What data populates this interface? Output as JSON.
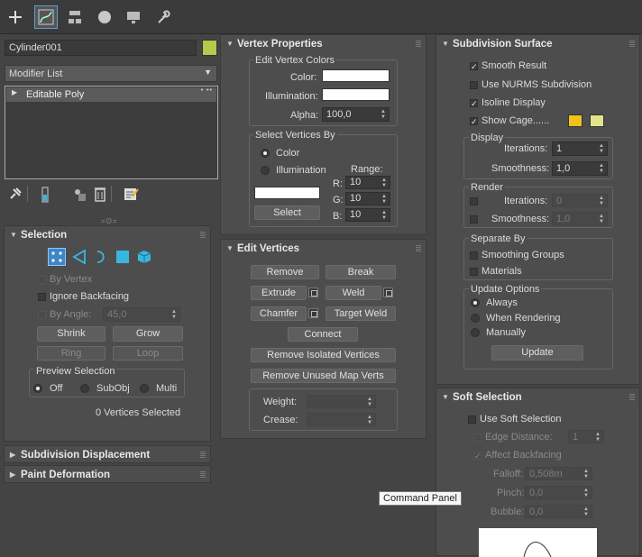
{
  "object_name": "Cylinder001",
  "object_color": "#b5c94a",
  "modifier_list": "Modifier List",
  "stack_item": "Editable Poly",
  "selection": {
    "title": "Selection",
    "by_vertex": "By Vertex",
    "ignore_backfacing": "Ignore Backfacing",
    "by_angle": "By Angle:",
    "angle_value": "45,0",
    "shrink": "Shrink",
    "grow": "Grow",
    "ring": "Ring",
    "loop": "Loop",
    "preview_title": "Preview Selection",
    "off": "Off",
    "subobj": "SubObj",
    "multi": "Multi",
    "status": "0 Vertices Selected"
  },
  "subdivision_displacement": "Subdivision Displacement",
  "paint_deformation": "Paint Deformation",
  "vertex_properties": {
    "title": "Vertex Properties",
    "edit_colors": "Edit Vertex Colors",
    "color": "Color:",
    "illumination": "Illumination:",
    "alpha": "Alpha:",
    "alpha_value": "100,0",
    "select_by": "Select Vertices By",
    "opt_color": "Color",
    "opt_illumination": "Illumination",
    "range": "Range:",
    "r": "R:",
    "g": "G:",
    "b": "B:",
    "r_val": "10",
    "g_val": "10",
    "b_val": "10",
    "select": "Select"
  },
  "edit_vertices": {
    "title": "Edit Vertices",
    "remove": "Remove",
    "break": "Break",
    "extrude": "Extrude",
    "weld": "Weld",
    "chamfer": "Chamfer",
    "target_weld": "Target Weld",
    "connect": "Connect",
    "remove_isolated": "Remove Isolated Vertices",
    "remove_unused": "Remove Unused Map Verts",
    "weight": "Weight:",
    "crease": "Crease:"
  },
  "subdivision_surface": {
    "title": "Subdivision Surface",
    "smooth_result": "Smooth Result",
    "use_nurms": "Use NURMS Subdivision",
    "isoline": "Isoline Display",
    "show_cage": "Show Cage......",
    "cage_color1": "#f2c21b",
    "cage_color2": "#e3e38c",
    "display": "Display",
    "iterations": "Iterations:",
    "iterations_value": "1",
    "smoothness": "Smoothness:",
    "smoothness_value": "1,0",
    "render": "Render",
    "render_iterations_value": "0",
    "render_smoothness_value": "1,0",
    "separate_by": "Separate By",
    "smoothing_groups": "Smoothing Groups",
    "materials": "Materials",
    "update_options": "Update Options",
    "always": "Always",
    "when_rendering": "When Rendering",
    "manually": "Manually",
    "update": "Update"
  },
  "soft_selection": {
    "title": "Soft Selection",
    "use_soft": "Use Soft Selection",
    "edge_distance": "Edge Distance:",
    "edge_value": "1",
    "affect_backfacing": "Affect Backfacing",
    "falloff": "Falloff:",
    "falloff_value": "0,508m",
    "pinch": "Pinch:",
    "pinch_value": "0,0",
    "bubble": "Bubble:",
    "bubble_value": "0,0"
  },
  "tooltip": "Command Panel"
}
